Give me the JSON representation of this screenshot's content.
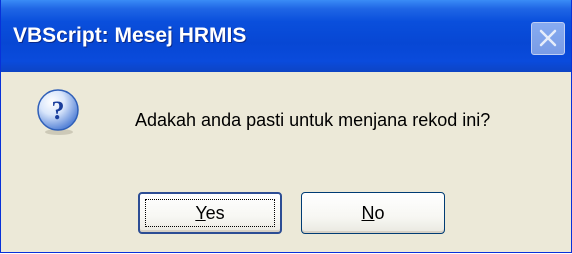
{
  "dialog": {
    "title": "VBScript: Mesej HRMIS",
    "message": "Adakah anda pasti untuk menjana rekod ini?",
    "icon": "question-icon",
    "buttons": {
      "yes_label": "Yes",
      "no_label": "No"
    },
    "close_icon": "close-icon"
  },
  "colors": {
    "titlebar": "#0a4fdc",
    "body": "#ece9d8",
    "button_border": "#003c74"
  }
}
